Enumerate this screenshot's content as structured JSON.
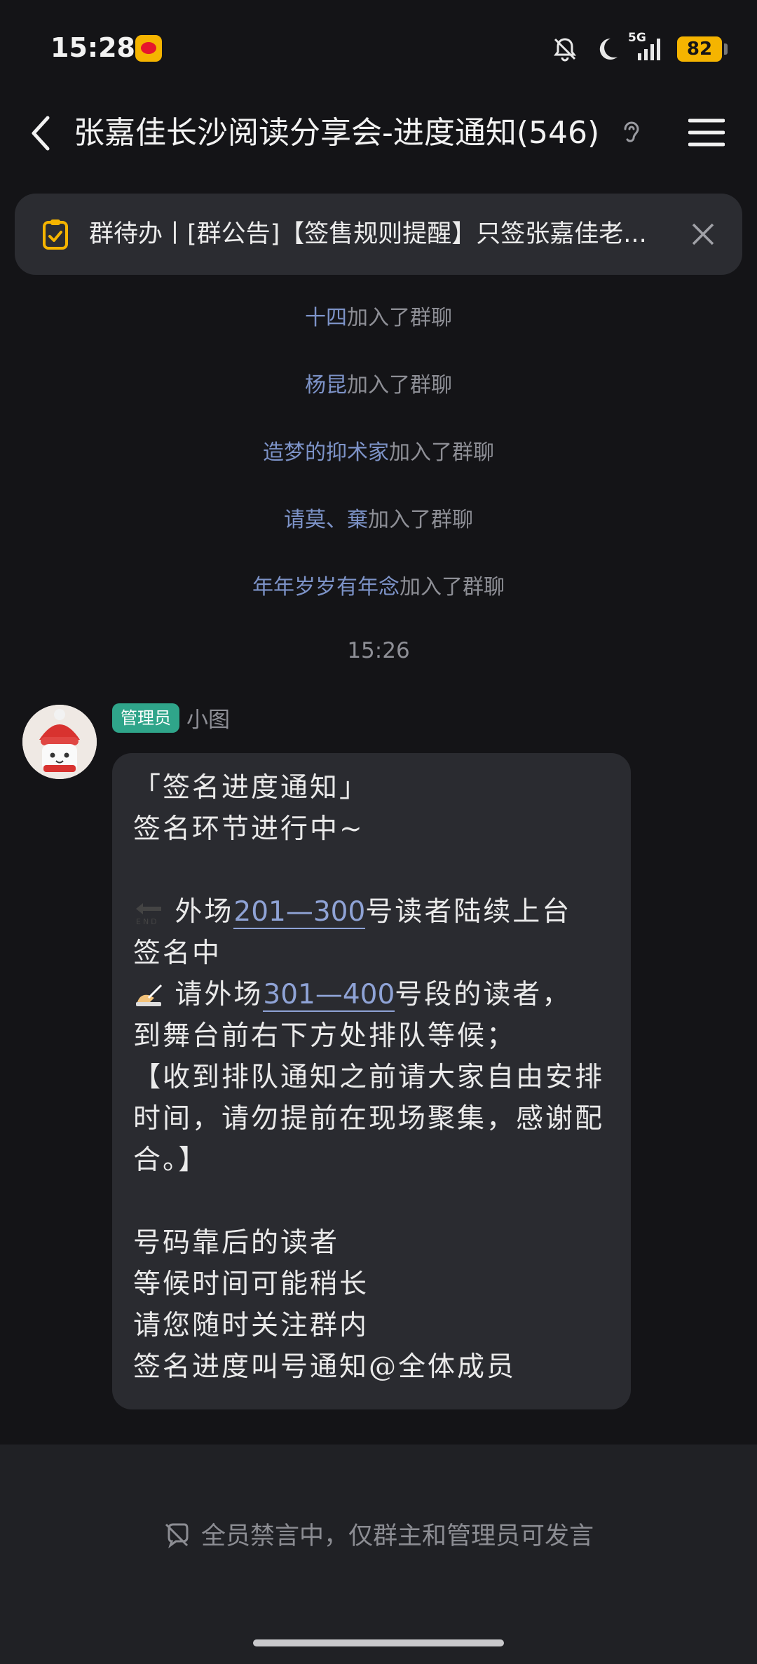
{
  "status_bar": {
    "time": "15:28",
    "network": "5G",
    "battery": "82",
    "icons": [
      "weibo-icon",
      "bell-muted-icon",
      "moon-icon",
      "signal-icon",
      "battery-icon"
    ]
  },
  "header": {
    "title": "张嘉佳长沙阅读分享会-进度通知(546)",
    "icons": [
      "back-icon",
      "ear-icon",
      "menu-icon"
    ]
  },
  "announcement": {
    "text": "群待办丨[群公告]【签售规则提醒】只签张嘉佳老...",
    "icons": [
      "todo-icon",
      "close-icon"
    ]
  },
  "system_messages": [
    {
      "name": "十四",
      "action": "加入了群聊"
    },
    {
      "name": "杨昆",
      "action": "加入了群聊"
    },
    {
      "name": "造梦的抑术家",
      "action": "加入了群聊"
    },
    {
      "name": "请莫、棄",
      "action": "加入了群聊"
    },
    {
      "name": "年年岁岁有年念",
      "action": "加入了群聊"
    }
  ],
  "timestamp": "15:26",
  "message": {
    "role_badge": "管理员",
    "sender": "小图",
    "line1": "「签名进度通知」",
    "line2": "签名环节进行中~",
    "line3_pre": " 外场",
    "line3_link": "201—300",
    "line3_post": "号读者陆续上台",
    "line4": "签名中",
    "line5_pre": " 请外场",
    "line5_link": "301—400",
    "line5_post": "号段的读者，",
    "line6": "到舞台前右下方处排队等候；",
    "line7": "【收到排队通知之前请大家自由安排时间，请勿提前在现场聚集，感谢配合。】",
    "line8": "号码靠后的读者",
    "line9": "等候时间可能稍长",
    "line10": "请您随时关注群内",
    "line11": "签名进度叫号通知@全体成员"
  },
  "bottom": {
    "mute_text": "全员禁言中，仅群主和管理员可发言"
  }
}
